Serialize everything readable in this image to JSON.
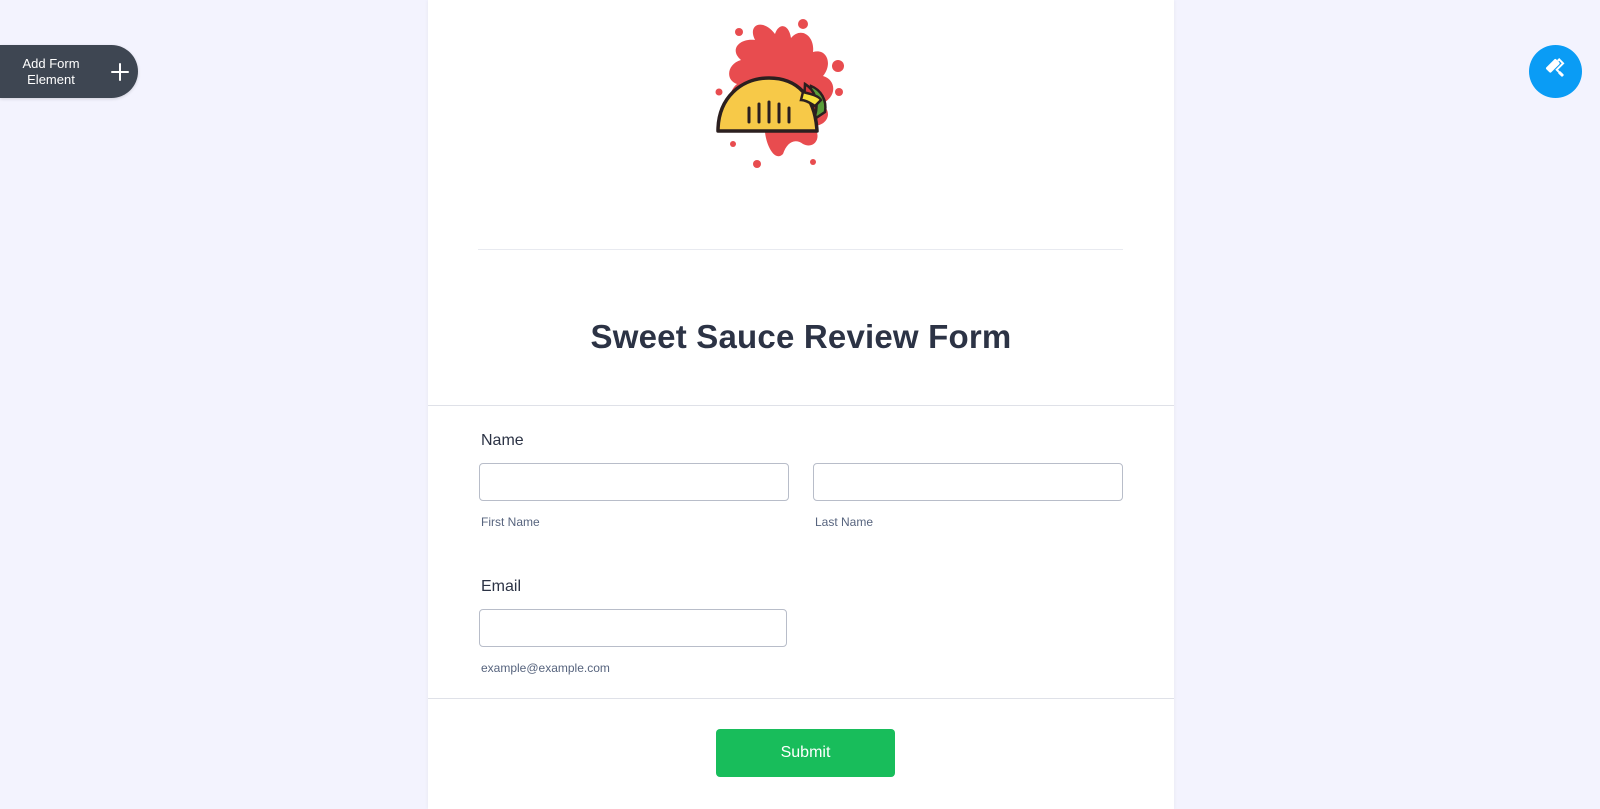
{
  "toolbar": {
    "add_element_label": "Add Form Element",
    "add_icon": "plus-icon",
    "designer_icon": "paint-roller-icon"
  },
  "form": {
    "title": "Sweet Sauce Review Form",
    "logo": "taco-splash-logo",
    "fields": {
      "name": {
        "label": "Name",
        "first_value": "",
        "first_sublabel": "First Name",
        "last_value": "",
        "last_sublabel": "Last Name"
      },
      "email": {
        "label": "Email",
        "value": "",
        "sublabel": "example@example.com"
      }
    },
    "submit_label": "Submit"
  },
  "colors": {
    "background": "#f3f3fe",
    "card": "#ffffff",
    "submit": "#18bd5b",
    "designer_button": "#0a9cf5",
    "add_element_bg": "#3e4652",
    "title_text": "#2c3345",
    "splash_red": "#e84c4f",
    "taco_yellow": "#f7c948"
  }
}
